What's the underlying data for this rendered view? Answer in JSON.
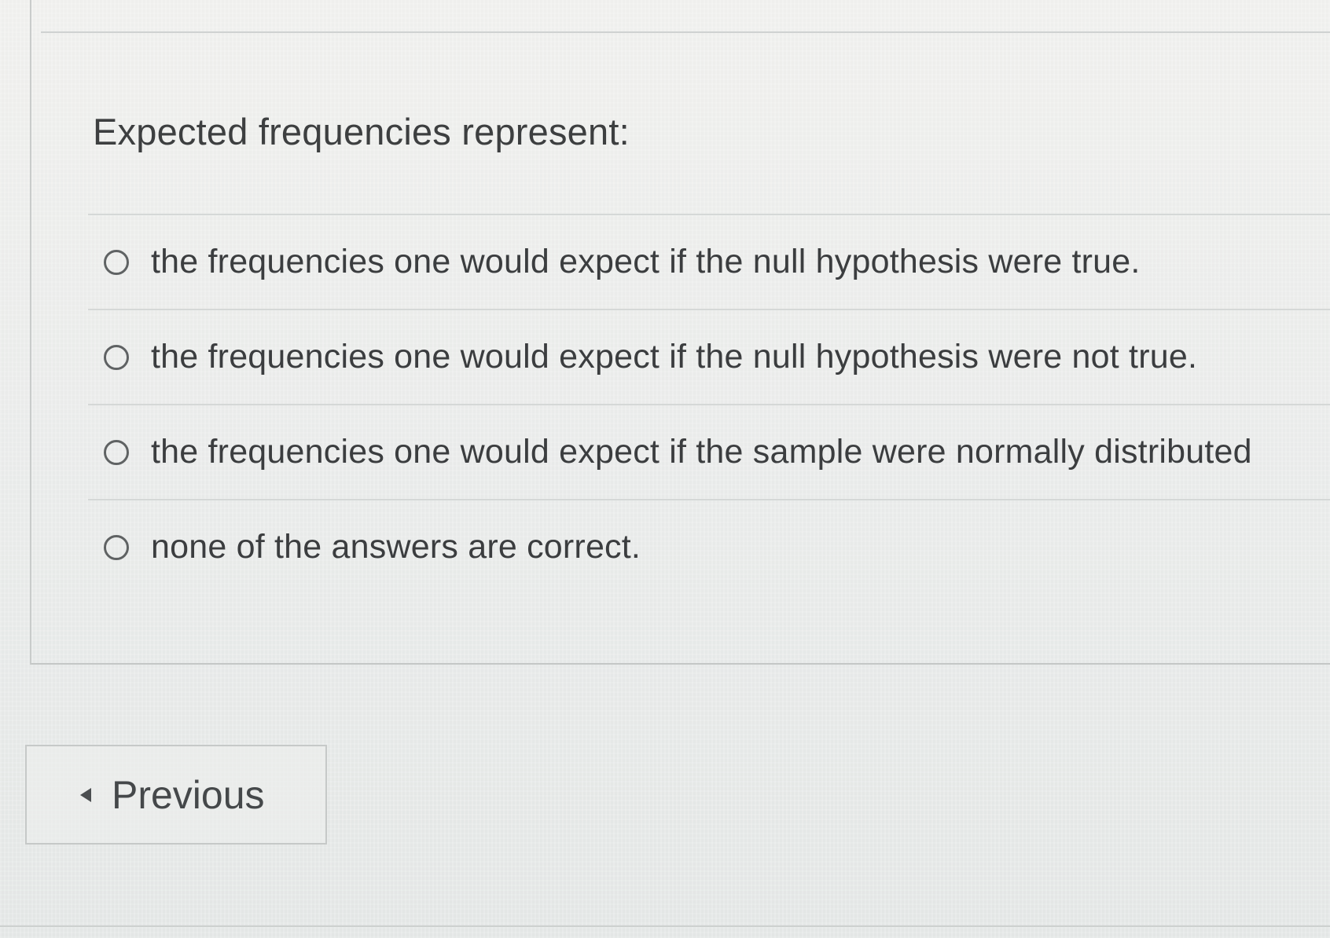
{
  "question": {
    "prompt": "Expected frequencies represent:",
    "options": [
      {
        "label": "the frequencies one would expect if the null hypothesis were true."
      },
      {
        "label": "the frequencies one would expect if the null hypothesis were not true."
      },
      {
        "label": "the frequencies one would expect if the sample were normally distributed"
      },
      {
        "label": "none of the answers are correct."
      }
    ]
  },
  "navigation": {
    "previous_label": "Previous",
    "previous_icon": "caret-left-icon"
  }
}
